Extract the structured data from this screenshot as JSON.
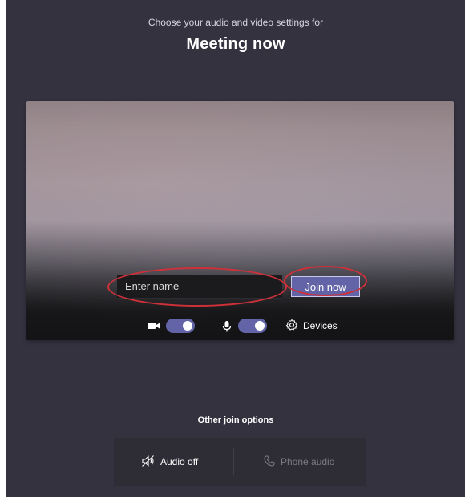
{
  "header": {
    "subtitle": "Choose your audio and video settings for",
    "title": "Meeting now"
  },
  "preview": {
    "name_input": {
      "value": "",
      "placeholder": "Enter name"
    },
    "join_button_label": "Join now",
    "controls": {
      "camera_icon": "video-camera-icon",
      "camera_toggle_on": true,
      "mic_icon": "microphone-icon",
      "mic_toggle_on": true,
      "devices_icon": "gear-icon",
      "devices_label": "Devices"
    }
  },
  "other_options": {
    "title": "Other join options",
    "audio_off_label": "Audio off",
    "audio_off_icon": "speaker-muted-icon",
    "phone_audio_label": "Phone audio",
    "phone_audio_icon": "phone-icon"
  },
  "colors": {
    "background": "#34323f",
    "accent": "#6264a7",
    "annotation": "#d0303a"
  }
}
